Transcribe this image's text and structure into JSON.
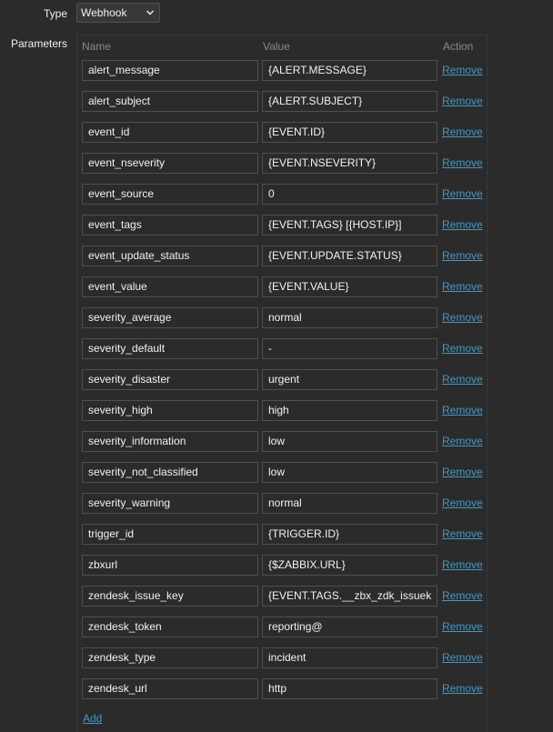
{
  "type_field": {
    "label": "Type",
    "value": "Webhook",
    "icon": "chevron-down-icon"
  },
  "parameters": {
    "label": "Parameters",
    "headers": {
      "name": "Name",
      "value": "Value",
      "action": "Action"
    },
    "rows": [
      {
        "name": "alert_message",
        "value": "{ALERT.MESSAGE}",
        "action": "Remove"
      },
      {
        "name": "alert_subject",
        "value": "{ALERT.SUBJECT}",
        "action": "Remove"
      },
      {
        "name": "event_id",
        "value": "{EVENT.ID}",
        "action": "Remove"
      },
      {
        "name": "event_nseverity",
        "value": "{EVENT.NSEVERITY}",
        "action": "Remove"
      },
      {
        "name": "event_source",
        "value": "0",
        "action": "Remove"
      },
      {
        "name": "event_tags",
        "value": "{EVENT.TAGS} [{HOST.IP}]",
        "action": "Remove"
      },
      {
        "name": "event_update_status",
        "value": "{EVENT.UPDATE.STATUS}",
        "action": "Remove"
      },
      {
        "name": "event_value",
        "value": "{EVENT.VALUE}",
        "action": "Remove"
      },
      {
        "name": "severity_average",
        "value": "normal",
        "action": "Remove"
      },
      {
        "name": "severity_default",
        "value": "-",
        "action": "Remove"
      },
      {
        "name": "severity_disaster",
        "value": "urgent",
        "action": "Remove"
      },
      {
        "name": "severity_high",
        "value": "high",
        "action": "Remove"
      },
      {
        "name": "severity_information",
        "value": "low",
        "action": "Remove"
      },
      {
        "name": "severity_not_classified",
        "value": "low",
        "action": "Remove"
      },
      {
        "name": "severity_warning",
        "value": "normal",
        "action": "Remove"
      },
      {
        "name": "trigger_id",
        "value": "{TRIGGER.ID}",
        "action": "Remove"
      },
      {
        "name": "zbxurl",
        "value": "{$ZABBIX.URL}",
        "action": "Remove"
      },
      {
        "name": "zendesk_issue_key",
        "value": "{EVENT.TAGS.__zbx_zdk_issuek",
        "action": "Remove"
      },
      {
        "name": "zendesk_token",
        "value": "reporting@",
        "action": "Remove"
      },
      {
        "name": "zendesk_type",
        "value": "incident",
        "action": "Remove"
      },
      {
        "name": "zendesk_url",
        "value": "http",
        "action": "Remove"
      }
    ],
    "add_label": "Add"
  }
}
